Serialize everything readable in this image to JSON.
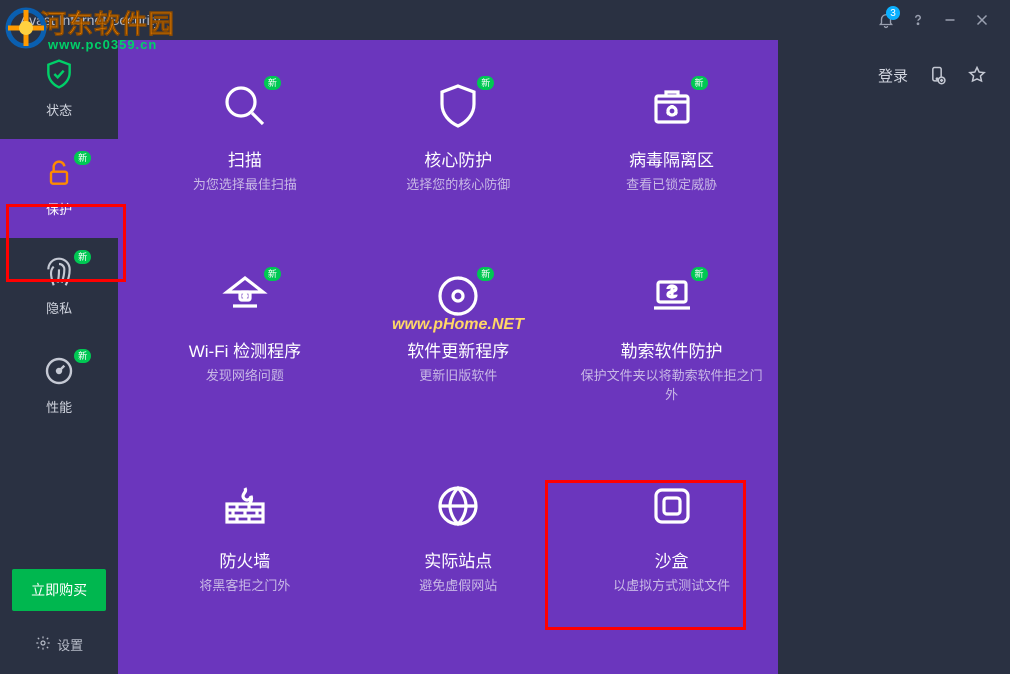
{
  "titlebar": {
    "app_title": "Avast Internet Security",
    "notification_count": "3"
  },
  "sidebar": {
    "items": [
      {
        "id": "status",
        "label": "状态",
        "new": false
      },
      {
        "id": "protect",
        "label": "保护",
        "new": true
      },
      {
        "id": "privacy",
        "label": "隐私",
        "new": true
      },
      {
        "id": "perf",
        "label": "性能",
        "new": true
      }
    ],
    "buy_label": "立即购买",
    "settings_label": "设置"
  },
  "right": {
    "login_label": "登录"
  },
  "tiles": [
    {
      "id": "scan",
      "title": "扫描",
      "desc": "为您选择最佳扫描",
      "new": true
    },
    {
      "id": "core-shield",
      "title": "核心防护",
      "desc": "选择您的核心防御",
      "new": true
    },
    {
      "id": "virus-chest",
      "title": "病毒隔离区",
      "desc": "查看已锁定威胁",
      "new": true
    },
    {
      "id": "wifi",
      "title": "Wi-Fi 检测程序",
      "desc": "发现网络问题",
      "new": true
    },
    {
      "id": "updater",
      "title": "软件更新程序",
      "desc": "更新旧版软件",
      "new": true
    },
    {
      "id": "ransom",
      "title": "勒索软件防护",
      "desc": "保护文件夹以将勒索软件拒之门外",
      "new": true
    },
    {
      "id": "firewall",
      "title": "防火墙",
      "desc": "将黑客拒之门外",
      "new": false
    },
    {
      "id": "realsite",
      "title": "实际站点",
      "desc": "避免虚假网站",
      "new": false
    },
    {
      "id": "sandbox",
      "title": "沙盒",
      "desc": "以虚拟方式测试文件",
      "new": false
    }
  ],
  "badges": {
    "new_label": "新"
  },
  "watermarks": {
    "site_name": "河东软件园",
    "site_url": "www.pc0359.cn",
    "site2": "www.pHome.NET"
  }
}
